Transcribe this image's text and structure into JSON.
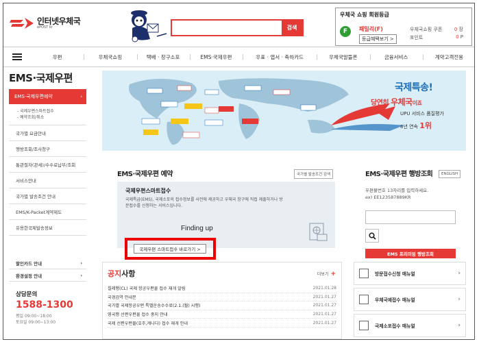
{
  "header": {
    "logo_text": "인터넷우체국",
    "logo_sub": "ePOST kr",
    "search_button": "검색",
    "search_value": ""
  },
  "member": {
    "title": "우체국 쇼핑 회원등급",
    "grade_letter": "F",
    "grade_name": "패밀리(F)",
    "benefit_button": "등급혜택보기 >",
    "rows": [
      {
        "label": "우체국쇼핑 쿠폰",
        "value": "0",
        "unit": "장"
      },
      {
        "label": "포인트",
        "value": "0",
        "unit": "P"
      }
    ]
  },
  "gnb": [
    "우편",
    "우체국쇼핑",
    "택배 · 창구소포",
    "EMS·국제우편",
    "우표 · 엽서 · 축하카드",
    "우체국알뜰폰",
    "금융서비스",
    "계약고객전용"
  ],
  "sidebar": {
    "page_title": "EMS·국제우편",
    "active_item": "EMS·국제우편예약",
    "active_arrow": "›",
    "sub_items": [
      "- 국제우편스마트접수",
      "- 예약조회/취소"
    ],
    "items": [
      "국가별 요금안내",
      "행방조회/조사청구",
      "통관절차(관세)/수수료납부/조회",
      "서비스안내",
      "국가별 발송조건 안내",
      "EMS/K-Packet계약제도",
      "유용한국제발송정보"
    ],
    "bottom_items": [
      "할인카드 안내",
      "환경설정 안내"
    ],
    "cs_label": "상담문의",
    "cs_phone": "1588-1300",
    "cs_hours": [
      "평일 09:00~18:00",
      "토요일 09:00~13:00"
    ]
  },
  "banner": {
    "title": "국제특송!",
    "subtitle_pre": "당연히",
    "subtitle_main": "우체국",
    "subtitle_post": "이죠",
    "line1": "UPU 서비스 품질평가",
    "line2_pre": "8년 연속",
    "line2_rank": "1위"
  },
  "reserve": {
    "title": "EMS·국제우편 예약",
    "cond_button": "국가별 발송조건 검색",
    "box_title": "국제우편스마트접수",
    "box_desc": "국제특급(EMS), 국제소포의 접수정보를 사전에 제공하고 우체국 창구에 직접 제출하거나 방문접수를 신청하는 서비스입니다.",
    "annotation": "Finding up",
    "go_button": "국제우편 스마트접수 바로가기 >"
  },
  "tracking": {
    "title": "EMS·국제우편 행방조회",
    "english_button": "ENGLISH",
    "desc": "우편물번호 13자리를 입력하세요.",
    "example": "ex) EE123587889KR",
    "input_value": "",
    "red_button": "EMS 프리미엄 행방조회"
  },
  "notice": {
    "title_hl": "공지",
    "title_rest": "사항",
    "more": "더보기",
    "more_icon": "+",
    "items": [
      {
        "title": "칠레행(CL) 국제 항공우편물 접수 재개 알림",
        "date": "2021.01.28"
      },
      {
        "title": "국경검역 안내문",
        "date": "2021.01.27"
      },
      {
        "title": "국가별 국제항공우편 특별운송수수료(2.1.(월) 시행)",
        "date": "2021.01.27"
      },
      {
        "title": "영국행 선편우편물 접수 중지 안내",
        "date": "2021.01.27"
      },
      {
        "title": "국제 선편우편물(호주,캐나다) 접수 재개 안내",
        "date": "2021.01.27"
      }
    ]
  },
  "shortcuts": [
    {
      "label": "방문접수신청 매뉴얼",
      "icon": "document-edit-icon"
    },
    {
      "label": "우체국예접수 매뉴얼",
      "icon": "monitor-icon"
    },
    {
      "label": "국제소포접수 매뉴얼",
      "icon": "box-icon"
    }
  ],
  "colors": {
    "accent": "#e53935",
    "blue": "#1d6fb8",
    "grade": "#2e9e35"
  }
}
